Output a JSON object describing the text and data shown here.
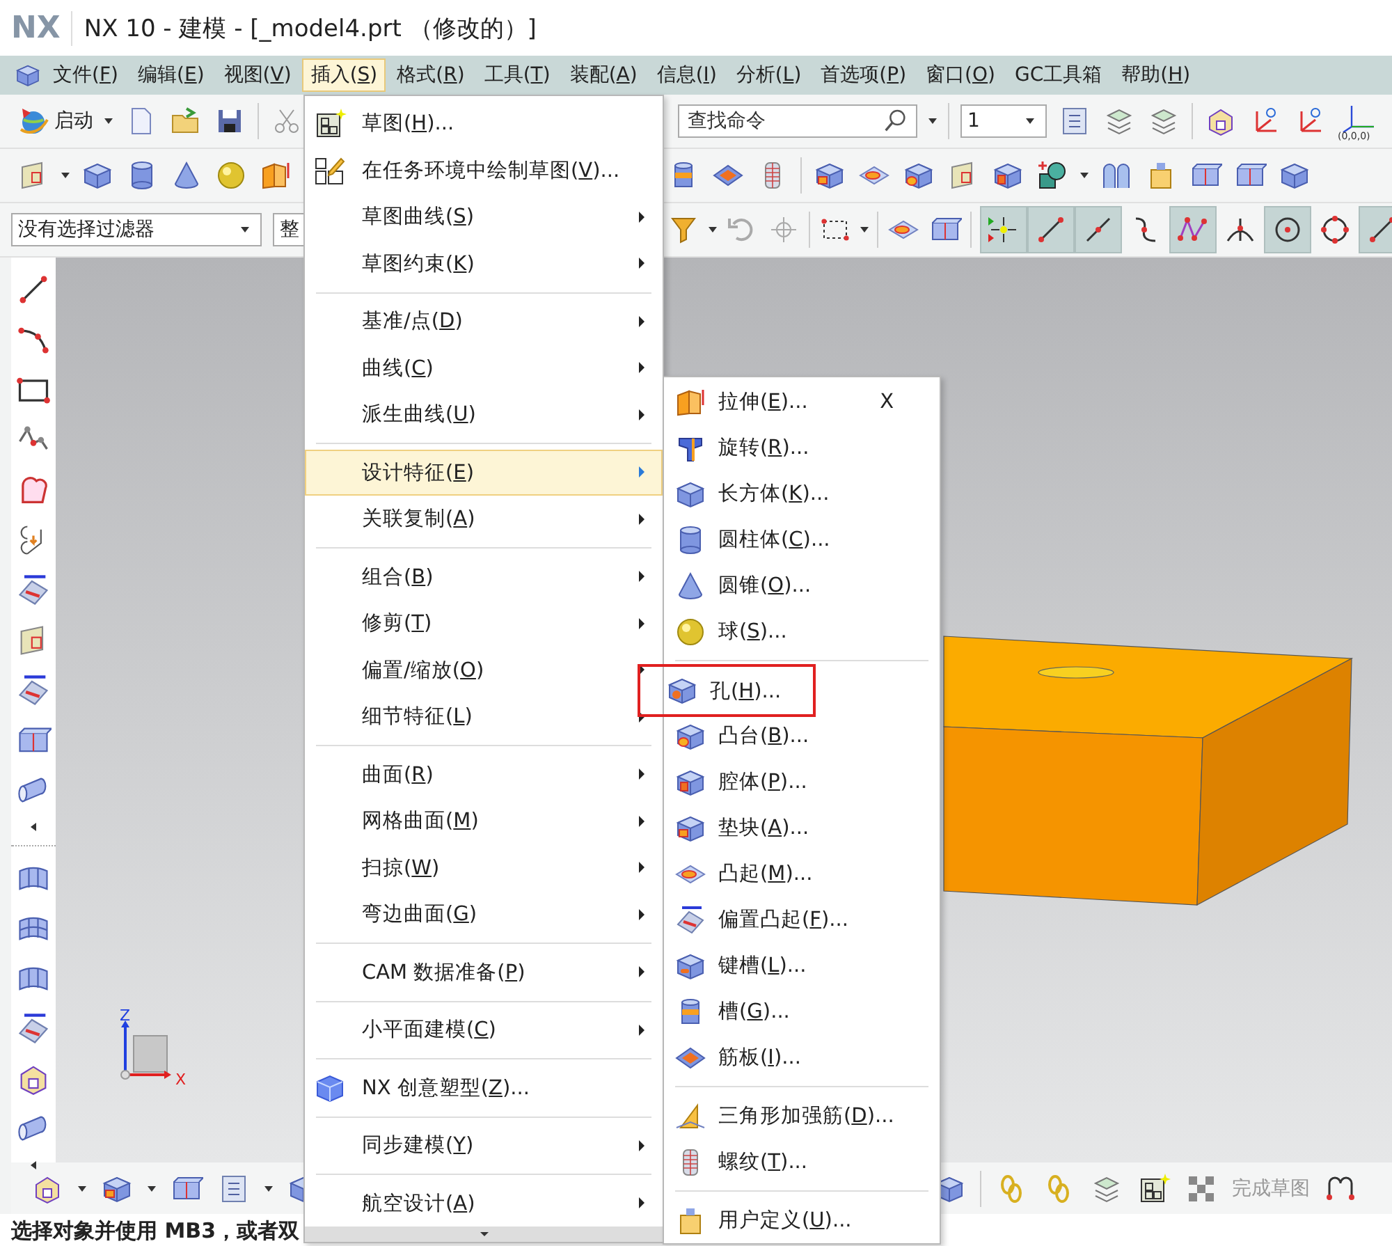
{
  "title_bar": {
    "logo": "NX",
    "title": "NX 10 - 建模 - [_model4.prt （修改的）]"
  },
  "menu_bar": [
    {
      "label": "文件(F)",
      "selected": false
    },
    {
      "label": "编辑(E)",
      "selected": false
    },
    {
      "label": "视图(V)",
      "selected": false
    },
    {
      "label": "插入(S)",
      "selected": true
    },
    {
      "label": "格式(R)",
      "selected": false
    },
    {
      "label": "工具(T)",
      "selected": false
    },
    {
      "label": "装配(A)",
      "selected": false
    },
    {
      "label": "信息(I)",
      "selected": false
    },
    {
      "label": "分析(L)",
      "selected": false
    },
    {
      "label": "首选项(P)",
      "selected": false
    },
    {
      "label": "窗口(O)",
      "selected": false
    },
    {
      "label": "GC工具箱",
      "selected": false
    },
    {
      "label": "帮助(H)",
      "selected": false
    }
  ],
  "toolbar_1": {
    "start_button": "启动",
    "search": {
      "placeholder": "查找命令"
    },
    "layer_selector": {
      "value": "1"
    },
    "origin_label": "(0,0,0)"
  },
  "toolbar_3": {
    "filter": {
      "value": "没有选择过滤器"
    },
    "scope": {
      "value": "整"
    },
    "snap_buttons": [
      {
        "on": true
      },
      {
        "on": true
      },
      {
        "on": true
      },
      {
        "on": false
      },
      {
        "on": true
      },
      {
        "on": false
      },
      {
        "on": true
      },
      {
        "on": false
      },
      {
        "on": true
      }
    ]
  },
  "viewport": {
    "triad": {
      "z_label": "Z",
      "x_label": "X"
    }
  },
  "bottom_toolbar": {
    "finish_sketch": "完成草图"
  },
  "status_bar": "选择对象并使用 MB3，或者双",
  "insert_menu": {
    "groups": [
      [
        {
          "label": "草图(H)...",
          "kind": "command",
          "selected": false
        },
        {
          "label": "在任务环境中绘制草图(V)...",
          "kind": "command",
          "selected": false
        },
        {
          "label": "草图曲线(S)",
          "kind": "submenu",
          "selected": false
        },
        {
          "label": "草图约束(K)",
          "kind": "submenu",
          "selected": false
        }
      ],
      [
        {
          "label": "基准/点(D)",
          "kind": "submenu",
          "selected": false
        },
        {
          "label": "曲线(C)",
          "kind": "submenu",
          "selected": false
        },
        {
          "label": "派生曲线(U)",
          "kind": "submenu",
          "selected": false
        }
      ],
      [
        {
          "label": "设计特征(E)",
          "kind": "submenu",
          "selected": true
        },
        {
          "label": "关联复制(A)",
          "kind": "submenu",
          "selected": false
        }
      ],
      [
        {
          "label": "组合(B)",
          "kind": "submenu",
          "selected": false
        },
        {
          "label": "修剪(T)",
          "kind": "submenu",
          "selected": false
        },
        {
          "label": "偏置/缩放(O)",
          "kind": "submenu",
          "selected": false
        },
        {
          "label": "细节特征(L)",
          "kind": "submenu",
          "selected": false
        }
      ],
      [
        {
          "label": "曲面(R)",
          "kind": "submenu",
          "selected": false
        },
        {
          "label": "网格曲面(M)",
          "kind": "submenu",
          "selected": false
        },
        {
          "label": "扫掠(W)",
          "kind": "submenu",
          "selected": false
        },
        {
          "label": "弯边曲面(G)",
          "kind": "submenu",
          "selected": false
        }
      ],
      [
        {
          "label": "CAM 数据准备(P)",
          "kind": "submenu",
          "selected": false
        }
      ],
      [
        {
          "label": "小平面建模(C)",
          "kind": "submenu",
          "selected": false
        }
      ],
      [
        {
          "label": "NX 创意塑型(Z)...",
          "kind": "command",
          "selected": false
        }
      ],
      [
        {
          "label": "同步建模(Y)",
          "kind": "submenu",
          "selected": false
        }
      ],
      [
        {
          "label": "航空设计(A)",
          "kind": "submenu",
          "selected": false
        }
      ]
    ]
  },
  "design_feature_menu": {
    "groups": [
      [
        {
          "label": "拉伸(E)...",
          "shortcut": "X",
          "framed": false
        },
        {
          "label": "旋转(R)...",
          "framed": false
        },
        {
          "label": "长方体(K)...",
          "framed": false
        },
        {
          "label": "圆柱体(C)...",
          "framed": false
        },
        {
          "label": "圆锥(O)...",
          "framed": false
        },
        {
          "label": "球(S)...",
          "framed": false
        }
      ],
      [
        {
          "label": "孔(H)...",
          "framed": true
        },
        {
          "label": "凸台(B)...",
          "framed": false
        },
        {
          "label": "腔体(P)...",
          "framed": false
        },
        {
          "label": "垫块(A)...",
          "framed": false
        },
        {
          "label": "凸起(M)...",
          "framed": false
        },
        {
          "label": "偏置凸起(F)...",
          "framed": false
        },
        {
          "label": "键槽(L)...",
          "framed": false
        },
        {
          "label": "槽(G)...",
          "framed": false
        },
        {
          "label": "筋板(I)...",
          "framed": false
        }
      ],
      [
        {
          "label": "三角形加强筋(D)...",
          "framed": false
        },
        {
          "label": "螺纹(T)...",
          "framed": false
        }
      ],
      [
        {
          "label": "用户定义(U)...",
          "framed": false
        }
      ]
    ]
  }
}
